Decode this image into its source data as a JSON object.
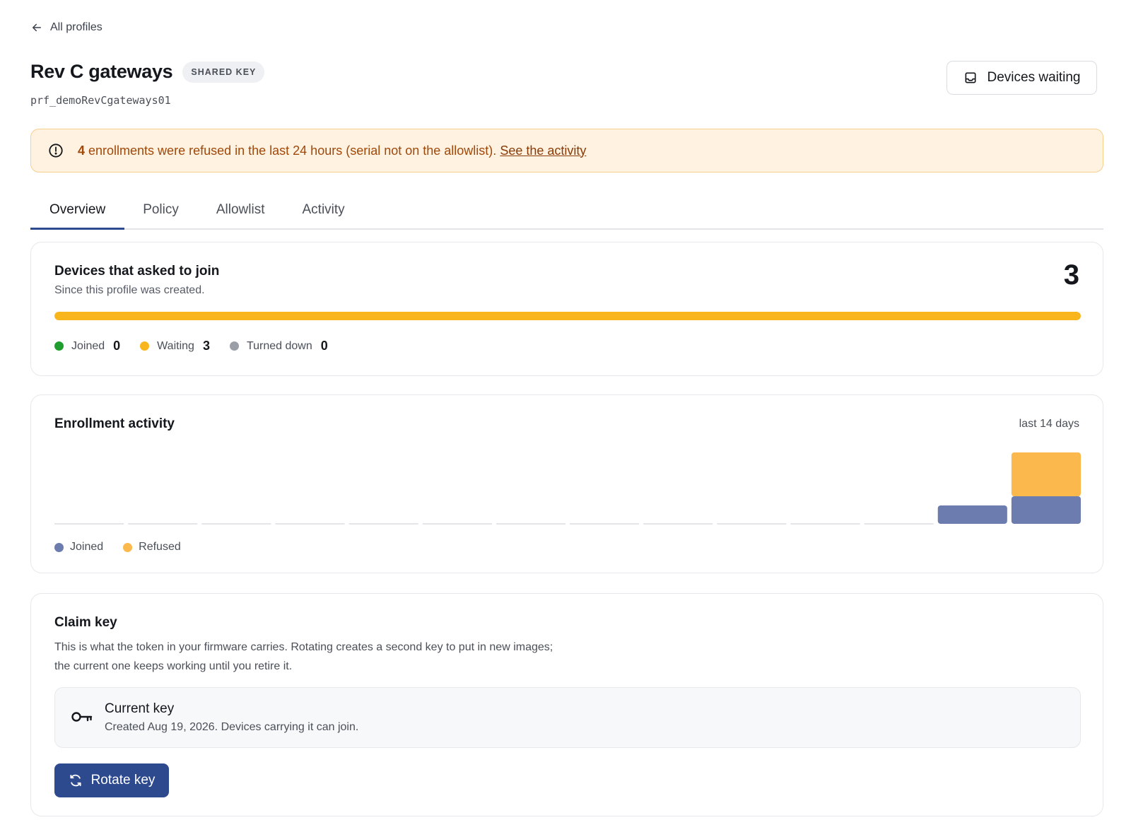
{
  "nav": {
    "back_label": "All profiles"
  },
  "profile": {
    "title": "Rev C gateways",
    "badge": "SHARED KEY",
    "id": "prf_demoRevCgateways01"
  },
  "header_actions": {
    "devices_waiting_label": "Devices waiting"
  },
  "alert": {
    "count": "4",
    "message": " enrollments were refused in the last 24 hours (serial not on the allowlist). ",
    "link_label": "See the activity",
    "color": "#a0480a"
  },
  "tabs": [
    {
      "label": "Overview",
      "active": true
    },
    {
      "label": "Policy",
      "active": false
    },
    {
      "label": "Allowlist",
      "active": false
    },
    {
      "label": "Activity",
      "active": false
    }
  ],
  "requests": {
    "title": "Devices that asked to join",
    "subtitle": "Since this profile was created.",
    "total": "3",
    "waiting_fraction": 1.0,
    "legend": [
      {
        "label": "Joined",
        "value": "0",
        "color": "#1f9d2e"
      },
      {
        "label": "Waiting",
        "value": "3",
        "color": "#f8b61c"
      },
      {
        "label": "Turned down",
        "value": "0",
        "color": "#9a9ea6"
      }
    ]
  },
  "activity": {
    "title": "Enrollment activity",
    "range_label": "last 14 days",
    "legend": [
      {
        "label": "Joined",
        "color": "#6d7cae"
      },
      {
        "label": "Refused",
        "color": "#fbb84d"
      }
    ]
  },
  "chart_data": {
    "type": "bar",
    "stacked": true,
    "categories": [
      "",
      "",
      "",
      "",
      "",
      "",
      "",
      "",
      "",
      "",
      "",
      "",
      "",
      ""
    ],
    "series": [
      {
        "name": "Joined",
        "values": [
          0,
          0,
          0,
          0,
          0,
          0,
          0,
          0,
          0,
          0,
          0,
          0,
          1,
          1.5
        ],
        "color": "#6d7cae"
      },
      {
        "name": "Refused",
        "values": [
          0,
          0,
          0,
          0,
          0,
          0,
          0,
          0,
          0,
          0,
          0,
          0,
          0,
          2.5
        ],
        "color": "#fbb84d"
      }
    ],
    "ymax": 4
  },
  "claim_key": {
    "title": "Claim key",
    "desc_line1": "This is what the token in your firmware carries. Rotating creates a second key to put in new images;",
    "desc_line2": "the current one keeps working until you retire it.",
    "current_title": "Current key",
    "current_sub": "Created Aug 19, 2026. Devices carrying it can join.",
    "rotate_label": "Rotate key",
    "button_color": "#2e4a8f"
  }
}
